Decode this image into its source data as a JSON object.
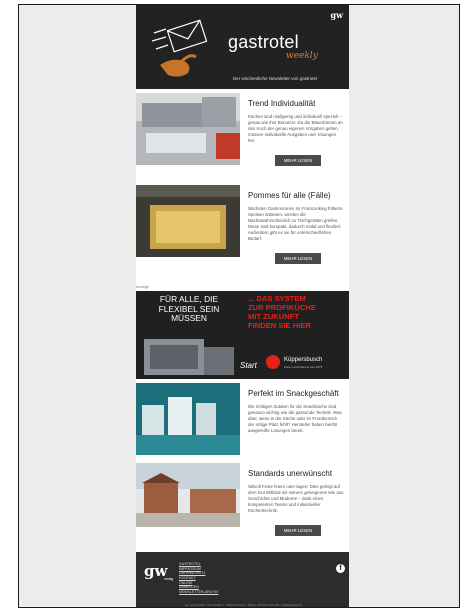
{
  "header": {
    "badge": "gw",
    "brand": "gastrotel",
    "subbrand": "weekly",
    "tagline": "Der wöchentliche Newsletter von gastrotel"
  },
  "articles": [
    {
      "title": "Trend Individualität",
      "text": "Küchen sind maßgertig und individuell speziell – genau wie ihre Benutzer. Da die Bäuerbörsen an den Koch der genau eigenen Vorgaben gelten, müssen individuelle Ausgaben und -lösungen her.",
      "button": "MEHR LESEN"
    },
    {
      "title": "Pommes für alle (Fälle)",
      "text": "Nächsten Gastronomen im Frontcooking frittierte Speisen anbieten, werden die Nächstwahrscheinlich zu Tischgeräten greifen. Diese sind kompakt, dadurch mobil und flexibel. Außerdem gibt es sie für unterschiedlichen Bedarf.",
      "button": "MEHR LESEN"
    },
    {
      "title": "Perfekt im Snackgeschäft",
      "text": "Die richtigen Zutaten für die Snackküche sind genauso wichtig wie die passende Technik. Was aber, wenn in der Küche oder im Frontbereich der nötige Platz fehlt? Hersteller haben hierfür ausgereifte Lösungen bereit.",
      "button": ""
    },
    {
      "title": "Standards unerwünscht",
      "text": "Stilvoll Feste feiern oder tagen: Dies gelingt auf dem Gut Willdod mit seinem gelungenen Mix aus Geschichte und Moderne – dank eines kompetenten Teams und individueller Küchentechnik.",
      "button": "MEHR LESEN"
    }
  ],
  "ad": {
    "label": "Anzeige",
    "left_lines": [
      "FÜR ALLE, DIE",
      "FLEXIBEL SEIN",
      "MÜSSEN"
    ],
    "right_lines": [
      "... DAS SYSTEM",
      "ZUR PROFIKÜCHE",
      "MIT ZUKUNFT",
      "FINDEN SIE HIER"
    ],
    "start_label": "Start",
    "brand": "Küppersbusch",
    "brand_sub": "Feuer und Flamme seit 1875"
  },
  "footer": {
    "logo": "gw",
    "verlag": "verlag",
    "links": [
      "GASTROTEL",
      "IMPRESSUM",
      "DATENSCHUTZ",
      "KONTAKT",
      "ONLINE",
      "ANMELDEN",
      "NEWSLETTER-ARCHIV"
    ],
    "facebook": "f",
    "imprint": "gw verlag GmbH · Neue Straße 1 · 30000 Hannover · Telefon +49 (0)511 123 456 · info@gastrotel.de"
  },
  "colors": {
    "accent": "#e07a2f",
    "ad_red": "#e32219",
    "button": "#4a4a4a"
  }
}
